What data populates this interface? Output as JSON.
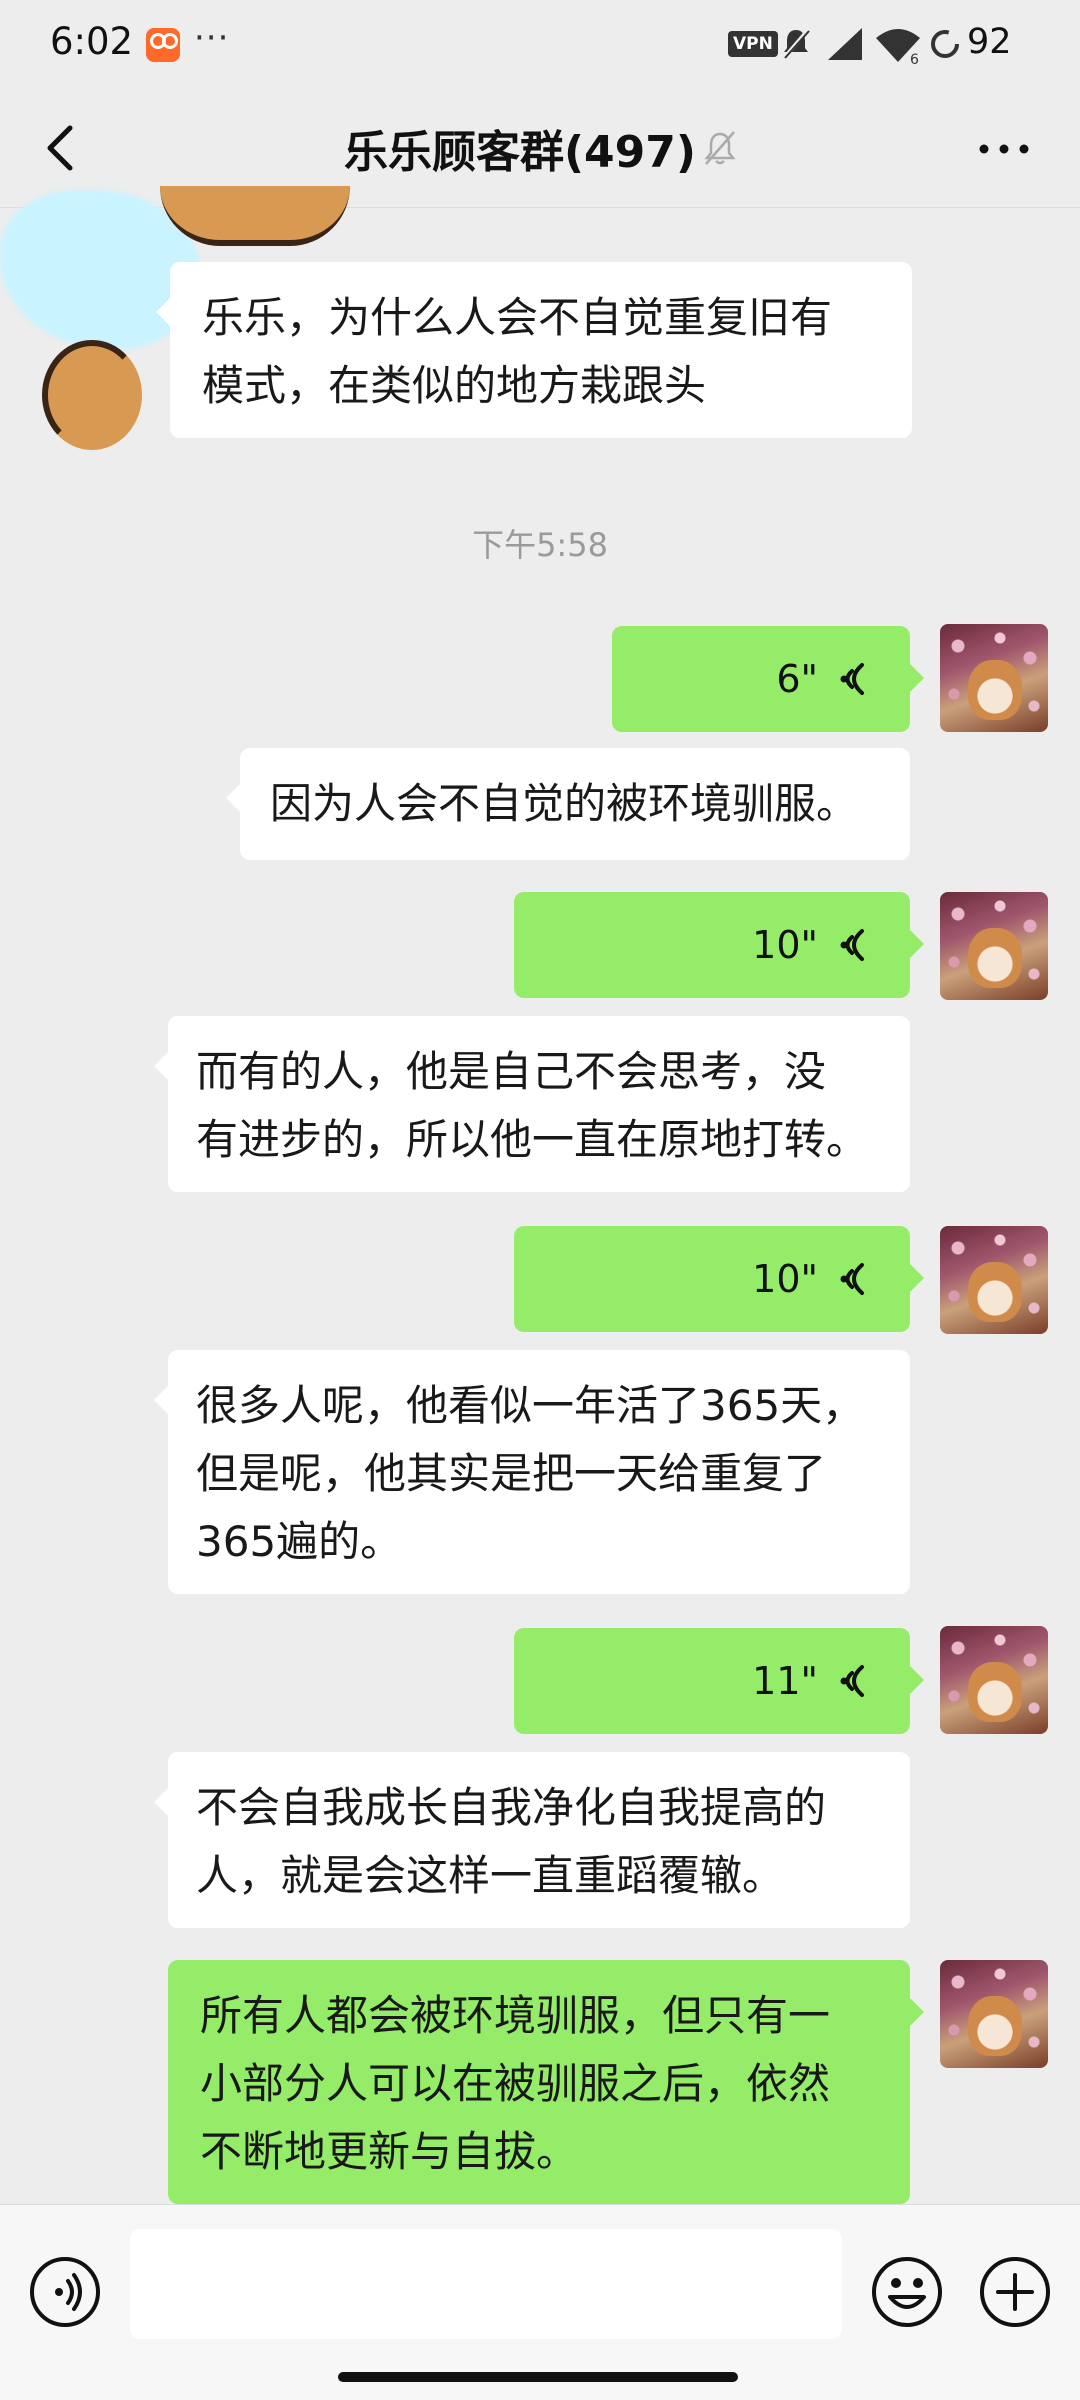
{
  "status_bar": {
    "time": "6:02",
    "dots": "···",
    "vpn": "VPN",
    "battery": "92"
  },
  "header": {
    "title": "乐乐顾客群(497)"
  },
  "messages": [
    {
      "id": "m1",
      "side": "left",
      "type": "text",
      "lines": [
        "乐乐，为什么人会不自觉重复旧有",
        "模式，在类似的地方栽跟头"
      ]
    },
    {
      "id": "ts1",
      "type": "timestamp",
      "text": "下午5:58"
    },
    {
      "id": "m2",
      "side": "right",
      "type": "voice",
      "duration": "6\""
    },
    {
      "id": "m3",
      "side": "left",
      "type": "text",
      "lines": [
        "因为人会不自觉的被环境驯服。"
      ]
    },
    {
      "id": "m4",
      "side": "right",
      "type": "voice",
      "duration": "10\""
    },
    {
      "id": "m5",
      "side": "left",
      "type": "text",
      "lines": [
        "而有的人，他是自己不会思考，没",
        "有进步的，所以他一直在原地打转。"
      ]
    },
    {
      "id": "m6",
      "side": "right",
      "type": "voice",
      "duration": "10\""
    },
    {
      "id": "m7",
      "side": "left",
      "type": "text",
      "lines": [
        "很多人呢，他看似一年活了365天，",
        "但是呢，他其实是把一天给重复了",
        "365遍的。"
      ]
    },
    {
      "id": "m8",
      "side": "right",
      "type": "voice",
      "duration": "11\""
    },
    {
      "id": "m9",
      "side": "left",
      "type": "text",
      "lines": [
        "不会自我成长自我净化自我提高的",
        "人，就是会这样一直重蹈覆辙。"
      ]
    },
    {
      "id": "m10",
      "side": "right",
      "type": "text",
      "lines": [
        "所有人都会被环境驯服，但只有一",
        "小部分人可以在被驯服之后，依然",
        "不断地更新与自拔。"
      ]
    }
  ],
  "input": {
    "value": "",
    "placeholder": ""
  },
  "icons": {
    "back": "chevron-left-icon",
    "mute": "bell-off-icon",
    "more": "more-horizontal-icon",
    "voice_toggle": "voice-input-icon",
    "emoji": "emoji-icon",
    "plus": "plus-circle-icon",
    "voice_wave": "voice-wave-icon"
  },
  "colors": {
    "background": "#ededed",
    "bubble_self": "#95ec69",
    "bubble_other": "#ffffff",
    "app_notification": "#ff6a2b"
  }
}
